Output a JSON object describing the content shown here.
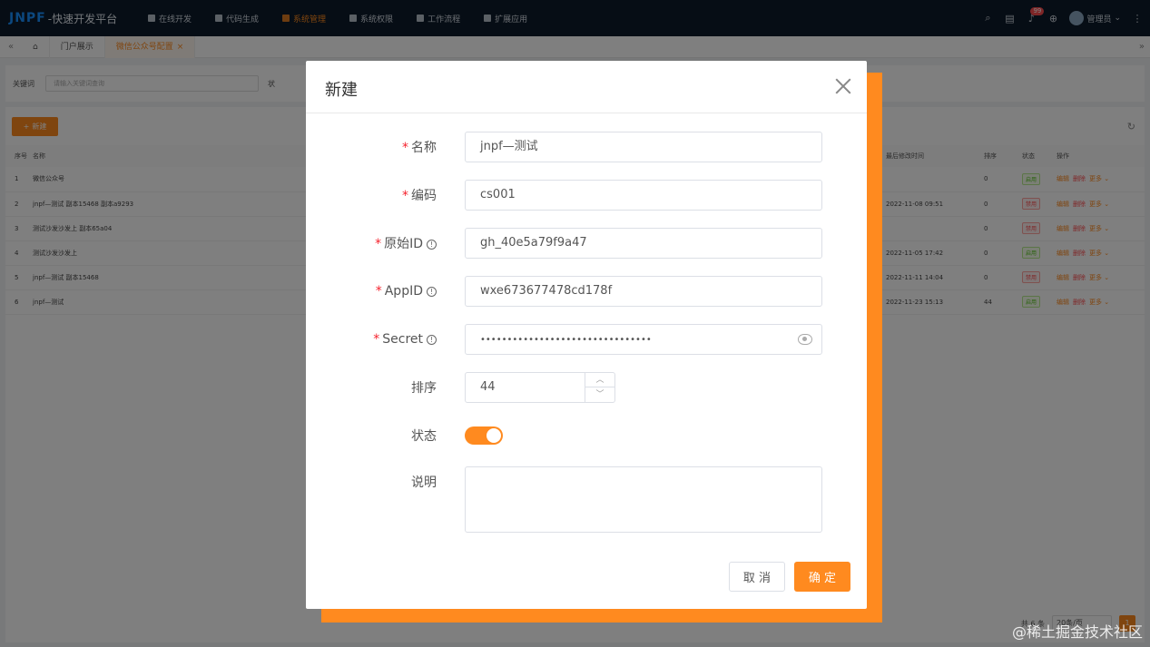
{
  "app": {
    "logo_mark": "JNPF",
    "logo_text": "-快速开发平台",
    "nav": [
      {
        "label": "在线开发",
        "icon": "monitor-icon"
      },
      {
        "label": "代码生成",
        "icon": "grid-icon"
      },
      {
        "label": "系统管理",
        "icon": "gear-icon",
        "active": true
      },
      {
        "label": "系统权限",
        "icon": "shield-icon"
      },
      {
        "label": "工作流程",
        "icon": "flow-icon"
      },
      {
        "label": "扩展应用",
        "icon": "apps-icon"
      }
    ],
    "notifications_count": "99",
    "user_name": "管理员"
  },
  "tabs": {
    "items": [
      "门户展示",
      "微信公众号配置"
    ],
    "active_index": 1
  },
  "search": {
    "keyword_label": "关键词",
    "keyword_placeholder": "请输入关键词查询",
    "status_label": "状"
  },
  "list": {
    "add_label": "新建",
    "columns": {
      "index": "序号",
      "name": "名称",
      "modified": "最后修改时间",
      "sort": "排序",
      "status": "状态",
      "ops": "操作"
    },
    "rows": [
      {
        "index": "1",
        "name": "微信公众号",
        "modified": "",
        "sort": "0",
        "status": "启用",
        "on": true
      },
      {
        "index": "2",
        "name": "jnpf—测试 副本15468 副本a9293",
        "modified": "2022-11-08 09:51",
        "sort": "0",
        "status": "禁用",
        "on": false
      },
      {
        "index": "3",
        "name": "测试沙发沙发上 副本65a04",
        "modified": "",
        "sort": "0",
        "status": "禁用",
        "on": false
      },
      {
        "index": "4",
        "name": "测试沙发沙发上",
        "modified": "2022-11-05 17:42",
        "sort": "0",
        "status": "启用",
        "on": true
      },
      {
        "index": "5",
        "name": "jnpf—测试 副本15468",
        "modified": "2022-11-11 14:04",
        "sort": "0",
        "status": "禁用",
        "on": false
      },
      {
        "index": "6",
        "name": "jnpf—测试",
        "modified": "2022-11-23 15:13",
        "sort": "44",
        "status": "启用",
        "on": true
      }
    ],
    "ops": {
      "edit": "编辑",
      "delete": "删除",
      "more": "更多"
    },
    "total": "共 6 条",
    "page_size": "20条/页",
    "page": "1"
  },
  "dialog": {
    "title": "新建",
    "fields": {
      "name_label": "名称",
      "name_value": "jnpf—测试",
      "code_label": "编码",
      "code_value": "cs001",
      "origin_id_label": "原始ID",
      "origin_id_value": "gh_40e5a79f9a47",
      "appid_label": "AppID",
      "appid_value": "wxe673677478cd178f",
      "secret_label": "Secret",
      "secret_value": "••••••••••••••••••••••••••••••••",
      "sort_label": "排序",
      "sort_value": "44",
      "status_label": "状态",
      "status_on": true,
      "desc_label": "说明"
    },
    "cancel_label": "取 消",
    "ok_label": "确 定"
  },
  "watermark": "@稀土掘金技术社区",
  "colors": {
    "accent": "#ff8a1f",
    "nav_bg": "#0d1b2a",
    "required": "#f5222d"
  }
}
